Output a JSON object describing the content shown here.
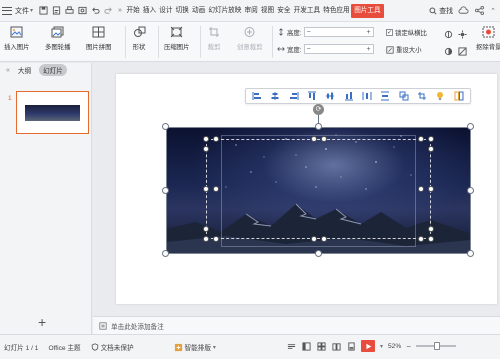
{
  "menu": {
    "file_label": "文件",
    "more": "»",
    "tabs": [
      "开始",
      "插入",
      "设计",
      "切换",
      "动画",
      "幻灯片放映",
      "审阅",
      "视图",
      "安全",
      "开发工具",
      "特色应用",
      "图片工具"
    ],
    "active_tab": "图片工具",
    "search_label": "查找"
  },
  "ribbon": {
    "insert_image": "插入图片",
    "multi_crop": "多图轮播",
    "image_puzzle": "图片拼图",
    "shape": "形状",
    "compress": "压缩图片",
    "crop": "裁剪",
    "recreate_crop": "创意裁剪",
    "height_label": "高度:",
    "width_label": "宽度:",
    "lock_ratio": "锁定纵横比",
    "reset_size": "重设大小",
    "remove_bg": "抠除背景"
  },
  "left_pane": {
    "outline_tab": "大纲",
    "slides_tab": "幻灯片",
    "slide_number": "1",
    "add_slide": "+"
  },
  "notes": {
    "placeholder": "单击此处添加备注"
  },
  "status": {
    "slide_count": "幻灯片 1 / 1",
    "theme": "Office 主题",
    "protect": "文档未保护",
    "smart_layout": "智能排版",
    "zoom": "52%"
  },
  "colors": {
    "accent": "#e74c3c",
    "thumb_border": "#e56a2e"
  }
}
